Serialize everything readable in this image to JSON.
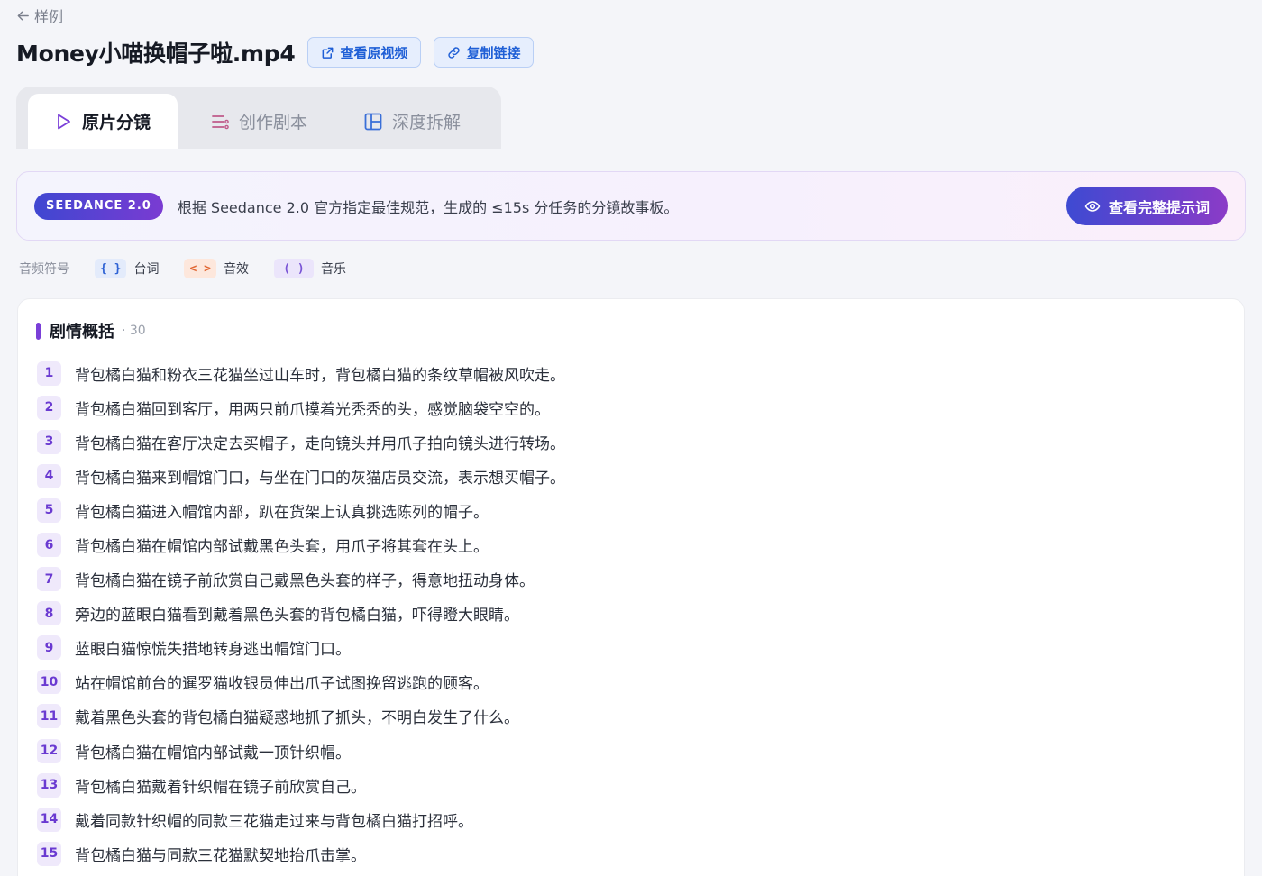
{
  "header": {
    "back_label": "样例",
    "title": "Money小喵换帽子啦.mp4",
    "view_original_label": "查看原视频",
    "copy_link_label": "复制链接"
  },
  "tabs": [
    {
      "label": "原片分镜",
      "icon": "play-icon",
      "active": true
    },
    {
      "label": "创作剧本",
      "icon": "list-icon",
      "active": false
    },
    {
      "label": "深度拆解",
      "icon": "layout-icon",
      "active": false
    }
  ],
  "banner": {
    "badge": "SEEDANCE 2.0",
    "text": "根据 Seedance 2.0 官方指定最佳规范，生成的 ≤15s 分任务的分镜故事板。",
    "button_label": "查看完整提示词",
    "button_icon": "eye-icon"
  },
  "legend": {
    "label": "音频符号",
    "items": [
      {
        "symbol": "{ }",
        "label": "台词",
        "color": "#2e62d4"
      },
      {
        "symbol": "< >",
        "label": "音效",
        "color": "#e16632"
      },
      {
        "symbol": "( )",
        "label": "音乐",
        "color": "#7a55d6"
      }
    ]
  },
  "summary": {
    "title": "剧情概括",
    "count": "· 30",
    "items": [
      {
        "num": "1",
        "text": "背包橘白猫和粉衣三花猫坐过山车时，背包橘白猫的条纹草帽被风吹走。"
      },
      {
        "num": "2",
        "text": "背包橘白猫回到客厅，用两只前爪摸着光秃秃的头，感觉脑袋空空的。"
      },
      {
        "num": "3",
        "text": "背包橘白猫在客厅决定去买帽子，走向镜头并用爪子拍向镜头进行转场。"
      },
      {
        "num": "4",
        "text": "背包橘白猫来到帽馆门口，与坐在门口的灰猫店员交流，表示想买帽子。"
      },
      {
        "num": "5",
        "text": "背包橘白猫进入帽馆内部，趴在货架上认真挑选陈列的帽子。"
      },
      {
        "num": "6",
        "text": "背包橘白猫在帽馆内部试戴黑色头套，用爪子将其套在头上。"
      },
      {
        "num": "7",
        "text": "背包橘白猫在镜子前欣赏自己戴黑色头套的样子，得意地扭动身体。"
      },
      {
        "num": "8",
        "text": "旁边的蓝眼白猫看到戴着黑色头套的背包橘白猫，吓得瞪大眼睛。"
      },
      {
        "num": "9",
        "text": "蓝眼白猫惊慌失措地转身逃出帽馆门口。"
      },
      {
        "num": "10",
        "text": "站在帽馆前台的暹罗猫收银员伸出爪子试图挽留逃跑的顾客。"
      },
      {
        "num": "11",
        "text": "戴着黑色头套的背包橘白猫疑惑地抓了抓头，不明白发生了什么。"
      },
      {
        "num": "12",
        "text": "背包橘白猫在帽馆内部试戴一顶针织帽。"
      },
      {
        "num": "13",
        "text": "背包橘白猫戴着针织帽在镜子前欣赏自己。"
      },
      {
        "num": "14",
        "text": "戴着同款针织帽的同款三花猫走过来与背包橘白猫打招呼。"
      },
      {
        "num": "15",
        "text": "背包橘白猫与同款三花猫默契地抬爪击掌。"
      }
    ]
  }
}
